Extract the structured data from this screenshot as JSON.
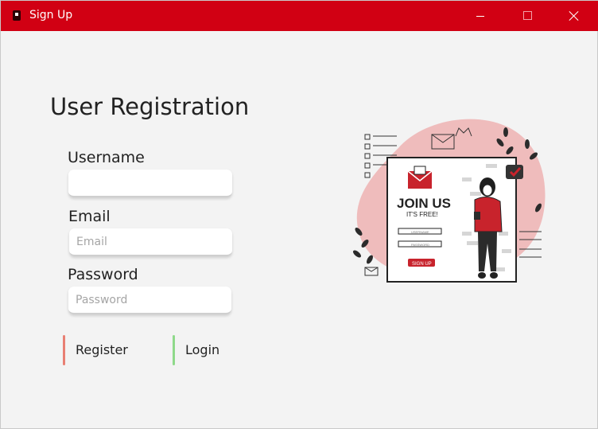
{
  "window": {
    "title": "Sign Up"
  },
  "form": {
    "heading": "User Registration",
    "username_label": "Username",
    "username_value": "",
    "username_placeholder": "",
    "email_label": "Email",
    "email_placeholder": "Email",
    "password_label": "Password",
    "password_placeholder": "Password",
    "register_label": "Register",
    "login_label": "Login"
  },
  "illustration": {
    "headline": "JOIN US",
    "subline": "IT'S FREE!",
    "field1": "USERNAME",
    "field2": "PASSWORD",
    "button": "SIGN UP"
  },
  "colors": {
    "titlebar": "#d10013",
    "register_accent": "#e87f73",
    "login_accent": "#8fd98a",
    "illustration_red": "#c8232c",
    "illustration_blob": "#efbcbc"
  }
}
